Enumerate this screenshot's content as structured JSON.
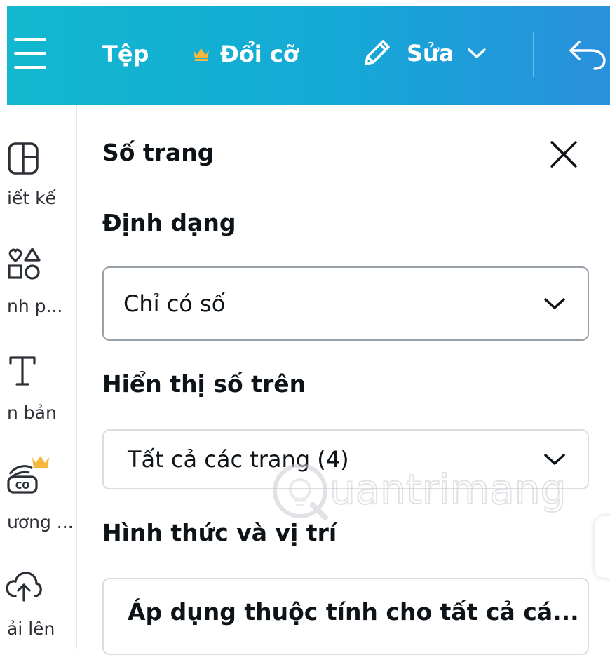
{
  "header": {
    "file_label": "Tệp",
    "resize_label": "Đổi cỡ",
    "edit_label": "Sửa",
    "colors": {
      "gradient_start": "#12b8cf",
      "gradient_end": "#2a8fdc",
      "crown": "#f5b83d"
    }
  },
  "sidebar": {
    "items": [
      {
        "label": "iết kế",
        "icon": "layout-icon"
      },
      {
        "label": "nh p...",
        "icon": "shapes-icon"
      },
      {
        "label": "n bản",
        "icon": "text-icon"
      },
      {
        "label": "ương ...",
        "icon": "brand-kit-icon"
      },
      {
        "label": "ải lên",
        "icon": "upload-icon"
      }
    ]
  },
  "panel": {
    "title": "Số trang",
    "format_label": "Định dạng",
    "format_value": "Chỉ có số",
    "display_label": "Hiển thị số trên",
    "display_value": "Tất cả các trang (4)",
    "style_label": "Hình thức và vị trí",
    "style_value": "Áp dụng thuộc tính cho tất cả cá..."
  },
  "watermark": {
    "text": "uantrimang"
  }
}
